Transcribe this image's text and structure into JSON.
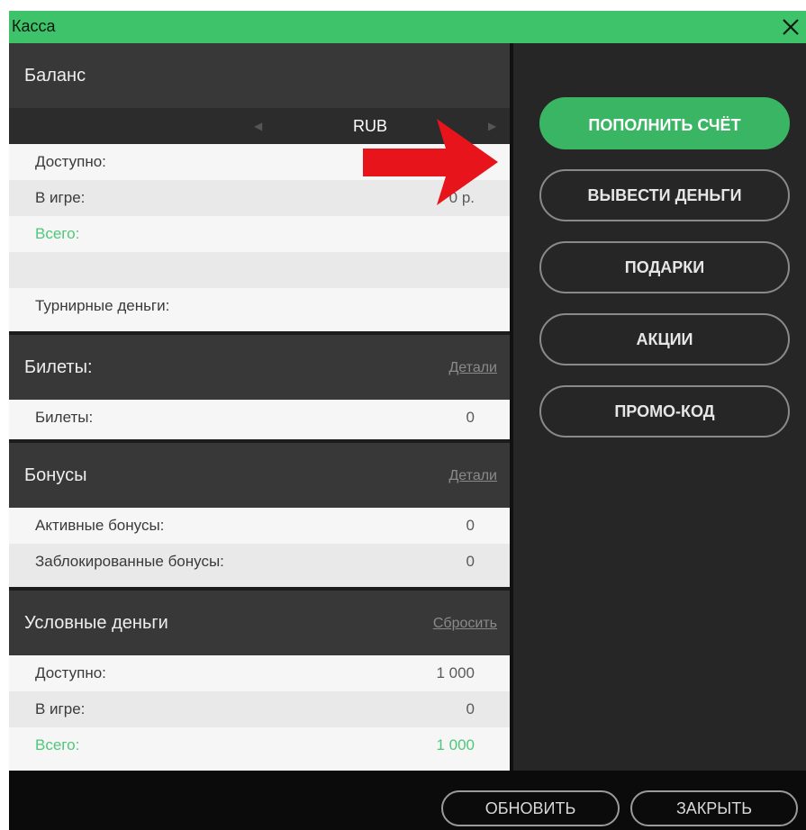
{
  "window": {
    "title": "Касса"
  },
  "balance": {
    "title": "Баланс",
    "currency": "RUB",
    "rows": [
      {
        "label": "Доступно:",
        "value": ""
      },
      {
        "label": "В игре:",
        "value": "0 р."
      },
      {
        "label": "Всего:",
        "value": ""
      },
      {
        "label": "",
        "value": ""
      },
      {
        "label": "Турнирные деньги:",
        "value": ""
      }
    ]
  },
  "tickets": {
    "title": "Билеты:",
    "link": "Детали",
    "rows": [
      {
        "label": "Билеты:",
        "value": "0"
      }
    ]
  },
  "bonuses": {
    "title": "Бонусы",
    "link": "Детали",
    "rows": [
      {
        "label": "Активные бонусы:",
        "value": "0"
      },
      {
        "label": "Заблокированные бонусы:",
        "value": "0"
      }
    ]
  },
  "play_money": {
    "title": "Условные деньги",
    "link": "Сбросить",
    "rows": [
      {
        "label": "Доступно:",
        "value": "1 000"
      },
      {
        "label": "В игре:",
        "value": "0"
      },
      {
        "label": "Всего:",
        "value": "1 000"
      }
    ]
  },
  "actions": {
    "deposit": "ПОПОЛНИТЬ СЧЁТ",
    "withdraw": "ВЫВЕСТИ ДЕНЬГИ",
    "gifts": "ПОДАРКИ",
    "promotions": "АКЦИИ",
    "promo_code": "ПРОМО-КОД"
  },
  "footer": {
    "refresh": "ОБНОВИТЬ",
    "close": "ЗАКРЫТЬ"
  },
  "icons": {
    "close": "close-icon",
    "prev_currency": "chevron-left-icon",
    "next_currency": "chevron-right-icon",
    "pointer": "red-arrow-icon"
  },
  "colors": {
    "accent": "#3ec26a",
    "total": "#4fc77b",
    "pointer": "#e8141b"
  }
}
